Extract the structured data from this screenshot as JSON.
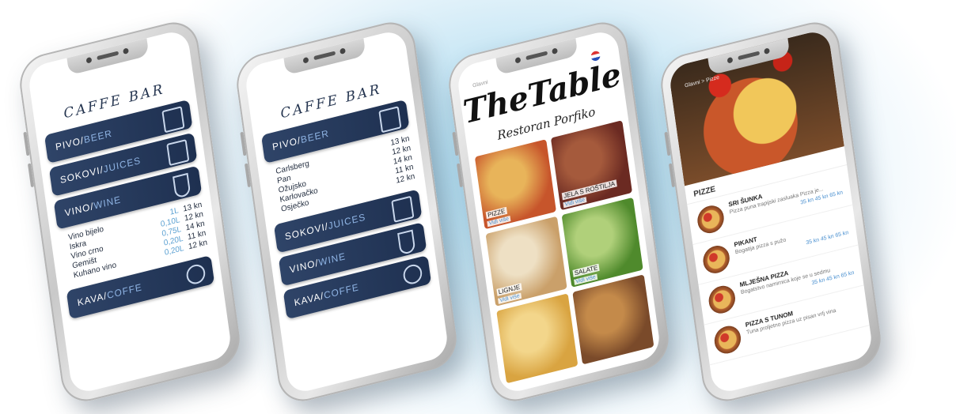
{
  "phone1": {
    "title": "CAFFE BAR",
    "categories": [
      {
        "main": "PIVO/",
        "sec": "BEER",
        "icon": "beer-mug-icon"
      },
      {
        "main": "SOKOVI/",
        "sec": "JUICES",
        "icon": "juice-bottle-icon"
      },
      {
        "main": "VINO/",
        "sec": "WINE",
        "icon": "wine-glass-icon"
      },
      {
        "main": "KAVA/",
        "sec": "COFFE",
        "icon": "coffee-bean-icon"
      }
    ],
    "wines": [
      {
        "name": "Vino bijelo",
        "amount": "1L",
        "price": "13 kn"
      },
      {
        "name": "Iskra",
        "amount": "0,10L",
        "price": "12 kn"
      },
      {
        "name": "Vino crno",
        "amount": "0,75L",
        "price": "14 kn"
      },
      {
        "name": "Gemišt",
        "amount": "0,20L",
        "price": "11 kn"
      },
      {
        "name": "Kuhano vino",
        "amount": "0,20L",
        "price": "12 kn"
      }
    ]
  },
  "phone2": {
    "title": "CAFFE BAR",
    "beer_category": {
      "main": "PIVO/",
      "sec": "BEER"
    },
    "beers": [
      {
        "name": "Carlsberg",
        "price": "13 kn"
      },
      {
        "name": "Pan",
        "price": "12 kn"
      },
      {
        "name": "Ožujsko",
        "price": "14 kn"
      },
      {
        "name": "Karlovačko",
        "price": "11 kn"
      },
      {
        "name": "Osječko",
        "price": "12 kn"
      }
    ],
    "other_categories": [
      {
        "main": "SOKOVI/",
        "sec": "JUICES"
      },
      {
        "main": "VINO/",
        "sec": "WINE"
      },
      {
        "main": "KAVA/",
        "sec": "COFFE"
      }
    ]
  },
  "phone3": {
    "breadcrumb": "Glavni",
    "logo": "TheTable",
    "subtitle": "Restoran Porfiko",
    "tiles": [
      {
        "label": "PIZZE",
        "more": "Vidi više",
        "colors": [
          "#c7552b",
          "#e8b45a"
        ]
      },
      {
        "label": "JELA S ROŠTILJA",
        "more": "Vidi više",
        "colors": [
          "#6b2a22",
          "#a55a3c"
        ]
      },
      {
        "label": "LIGNJE",
        "more": "Vidi više",
        "colors": [
          "#caa06a",
          "#eee0c4"
        ]
      },
      {
        "label": "SALATE",
        "more": "Vidi više",
        "colors": [
          "#4f8a2c",
          "#b0d07a"
        ]
      },
      {
        "label": "",
        "more": "",
        "colors": [
          "#d9a441",
          "#f3d68b"
        ]
      },
      {
        "label": "",
        "more": "",
        "colors": [
          "#7a4a2a",
          "#c48a4a"
        ]
      }
    ]
  },
  "phone4": {
    "breadcrumb": "Glavni > Pizze",
    "section": "PIZZE",
    "items": [
      {
        "name": "SRI ŠUNKA",
        "desc": "Pizza puna trapijski zasluaka Pizza je...",
        "price": "35 kn  45 kn  65 kn"
      },
      {
        "name": "PIKANT",
        "desc": "Bogatija pizza s pužo",
        "price": "35 kn  45 kn  65 kn"
      },
      {
        "name": "MLJEŠNA PIZZA",
        "desc": "Bogatstvo namirnica koje se u sedmu",
        "price": "35 kn  45 kn  65 kn"
      },
      {
        "name": "PIZZA S TUNOM",
        "desc": "Tuna proljetno pizza uz pisan vrlj vina",
        "price": ""
      }
    ]
  }
}
